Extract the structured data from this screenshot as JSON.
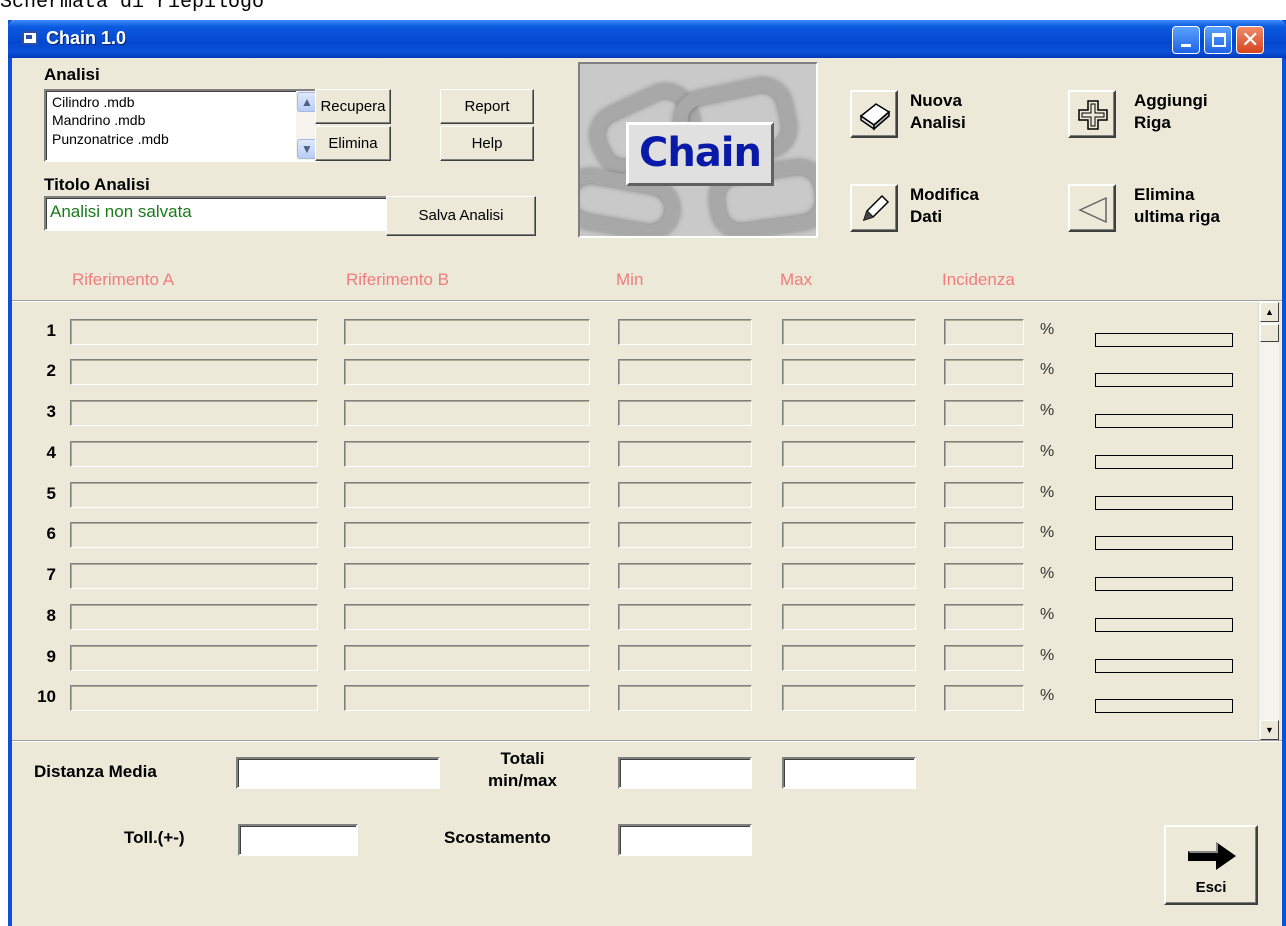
{
  "caption": "Schermata di riepilogo",
  "window": {
    "title": "Chain 1.0"
  },
  "analisi": {
    "label": "Analisi",
    "files": [
      "Cilindro .mdb",
      "Mandrino .mdb",
      "Punzonatrice .mdb"
    ],
    "recupera": "Recupera",
    "elimina": "Elimina",
    "report": "Report",
    "help": "Help"
  },
  "titolo": {
    "label": "Titolo Analisi",
    "value": "Analisi non salvata",
    "salva": "Salva Analisi"
  },
  "logo": {
    "text": "Chain"
  },
  "actions": {
    "nuova": "Nuova\nAnalisi",
    "aggiungi": "Aggiungi\nRiga",
    "modifica": "Modifica\nDati",
    "elimina_riga": "Elimina\nultima riga"
  },
  "columns": {
    "rif_a": "Riferimento A",
    "rif_b": "Riferimento B",
    "min": "Min",
    "max": "Max",
    "incidenza": "Incidenza"
  },
  "rows": [
    {
      "num": "1",
      "pct": "%"
    },
    {
      "num": "2",
      "pct": "%"
    },
    {
      "num": "3",
      "pct": "%"
    },
    {
      "num": "4",
      "pct": "%"
    },
    {
      "num": "5",
      "pct": "%"
    },
    {
      "num": "6",
      "pct": "%"
    },
    {
      "num": "7",
      "pct": "%"
    },
    {
      "num": "8",
      "pct": "%"
    },
    {
      "num": "9",
      "pct": "%"
    },
    {
      "num": "10",
      "pct": "%"
    }
  ],
  "bottom": {
    "distanza_media": "Distanza Media",
    "totali": "Totali\nmin/max",
    "toll": "Toll.(+-)",
    "scostamento": "Scostamento",
    "esci": "Esci"
  },
  "colors": {
    "header_text": "#f07d7d",
    "title_value": "#1a7a1a",
    "logo_text": "#0a1aa8"
  }
}
